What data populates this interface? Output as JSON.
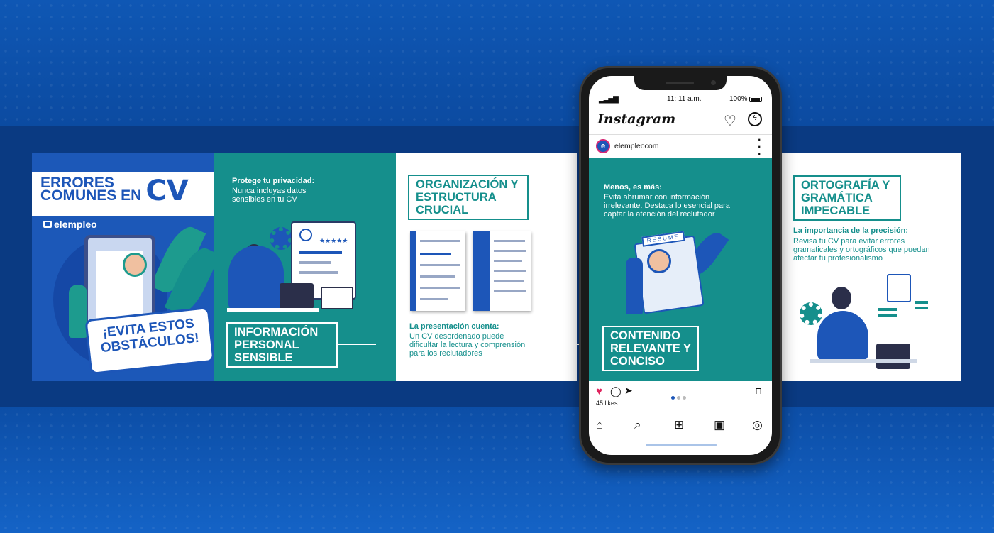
{
  "panel1": {
    "title_line1": "ERRORES",
    "title_line2": "COMUNES EN",
    "title_cv": "CV",
    "brand": "elempleo",
    "sticker_line1": "¡EVITA ESTOS",
    "sticker_line2": "OBSTÁCULOS!"
  },
  "panel2": {
    "heading": "Protege tu privacidad:",
    "text": "Nunca incluyas datos sensibles en tu CV",
    "box_title": "INFORMACIÓN PERSONAL SENSIBLE"
  },
  "panel3": {
    "box_title": "ORGANIZACIÓN Y ESTRUCTURA CRUCIAL",
    "heading": "La presentación cuenta:",
    "text": "Un CV desordenado puede dificultar la lectura y comprensión para los reclutadores"
  },
  "panel4": {
    "box_title": "ORTOGRAFÍA Y GRAMÁTICA IMPECABLE",
    "heading": "La importancia de la precisión:",
    "text": "Revisa tu CV para evitar errores gramaticales y ortográficos que puedan afectar tu profesionalismo"
  },
  "phone": {
    "status_time": "11: 11 a.m.",
    "status_battery": "100%",
    "app_name": "Instagram",
    "username": "elempleocom",
    "post": {
      "heading": "Menos, es más:",
      "text": "Evita abrumar con información irrelevante. Destaca lo esencial para captar la atención del reclutador",
      "resume_label": "RESUME",
      "box_title": "CONTENIDO RELEVANTE Y CONCISO"
    },
    "likes": "45 likes"
  },
  "icons": {
    "heart": "heart-icon",
    "messenger": "messenger-icon",
    "comment": "comment-icon",
    "share": "share-icon",
    "save": "bookmark-icon",
    "home": "home-icon",
    "search": "search-icon",
    "add": "add-post-icon",
    "reels": "reels-icon",
    "profile": "profile-icon"
  },
  "colors": {
    "brand_blue": "#1d56b8",
    "teal": "#158f8c",
    "like_red": "#e0245e"
  }
}
